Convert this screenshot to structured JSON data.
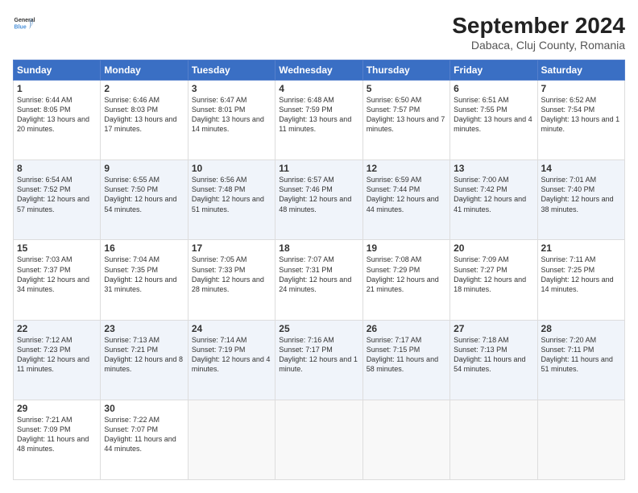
{
  "header": {
    "logo_general": "General",
    "logo_blue": "Blue",
    "title": "September 2024",
    "subtitle": "Dabaca, Cluj County, Romania"
  },
  "days_of_week": [
    "Sunday",
    "Monday",
    "Tuesday",
    "Wednesday",
    "Thursday",
    "Friday",
    "Saturday"
  ],
  "weeks": [
    [
      {
        "day": "1",
        "sunrise": "6:44 AM",
        "sunset": "8:05 PM",
        "daylight": "13 hours and 20 minutes."
      },
      {
        "day": "2",
        "sunrise": "6:46 AM",
        "sunset": "8:03 PM",
        "daylight": "13 hours and 17 minutes."
      },
      {
        "day": "3",
        "sunrise": "6:47 AM",
        "sunset": "8:01 PM",
        "daylight": "13 hours and 14 minutes."
      },
      {
        "day": "4",
        "sunrise": "6:48 AM",
        "sunset": "7:59 PM",
        "daylight": "13 hours and 11 minutes."
      },
      {
        "day": "5",
        "sunrise": "6:50 AM",
        "sunset": "7:57 PM",
        "daylight": "13 hours and 7 minutes."
      },
      {
        "day": "6",
        "sunrise": "6:51 AM",
        "sunset": "7:55 PM",
        "daylight": "13 hours and 4 minutes."
      },
      {
        "day": "7",
        "sunrise": "6:52 AM",
        "sunset": "7:54 PM",
        "daylight": "13 hours and 1 minute."
      }
    ],
    [
      {
        "day": "8",
        "sunrise": "6:54 AM",
        "sunset": "7:52 PM",
        "daylight": "12 hours and 57 minutes."
      },
      {
        "day": "9",
        "sunrise": "6:55 AM",
        "sunset": "7:50 PM",
        "daylight": "12 hours and 54 minutes."
      },
      {
        "day": "10",
        "sunrise": "6:56 AM",
        "sunset": "7:48 PM",
        "daylight": "12 hours and 51 minutes."
      },
      {
        "day": "11",
        "sunrise": "6:57 AM",
        "sunset": "7:46 PM",
        "daylight": "12 hours and 48 minutes."
      },
      {
        "day": "12",
        "sunrise": "6:59 AM",
        "sunset": "7:44 PM",
        "daylight": "12 hours and 44 minutes."
      },
      {
        "day": "13",
        "sunrise": "7:00 AM",
        "sunset": "7:42 PM",
        "daylight": "12 hours and 41 minutes."
      },
      {
        "day": "14",
        "sunrise": "7:01 AM",
        "sunset": "7:40 PM",
        "daylight": "12 hours and 38 minutes."
      }
    ],
    [
      {
        "day": "15",
        "sunrise": "7:03 AM",
        "sunset": "7:37 PM",
        "daylight": "12 hours and 34 minutes."
      },
      {
        "day": "16",
        "sunrise": "7:04 AM",
        "sunset": "7:35 PM",
        "daylight": "12 hours and 31 minutes."
      },
      {
        "day": "17",
        "sunrise": "7:05 AM",
        "sunset": "7:33 PM",
        "daylight": "12 hours and 28 minutes."
      },
      {
        "day": "18",
        "sunrise": "7:07 AM",
        "sunset": "7:31 PM",
        "daylight": "12 hours and 24 minutes."
      },
      {
        "day": "19",
        "sunrise": "7:08 AM",
        "sunset": "7:29 PM",
        "daylight": "12 hours and 21 minutes."
      },
      {
        "day": "20",
        "sunrise": "7:09 AM",
        "sunset": "7:27 PM",
        "daylight": "12 hours and 18 minutes."
      },
      {
        "day": "21",
        "sunrise": "7:11 AM",
        "sunset": "7:25 PM",
        "daylight": "12 hours and 14 minutes."
      }
    ],
    [
      {
        "day": "22",
        "sunrise": "7:12 AM",
        "sunset": "7:23 PM",
        "daylight": "12 hours and 11 minutes."
      },
      {
        "day": "23",
        "sunrise": "7:13 AM",
        "sunset": "7:21 PM",
        "daylight": "12 hours and 8 minutes."
      },
      {
        "day": "24",
        "sunrise": "7:14 AM",
        "sunset": "7:19 PM",
        "daylight": "12 hours and 4 minutes."
      },
      {
        "day": "25",
        "sunrise": "7:16 AM",
        "sunset": "7:17 PM",
        "daylight": "12 hours and 1 minute."
      },
      {
        "day": "26",
        "sunrise": "7:17 AM",
        "sunset": "7:15 PM",
        "daylight": "11 hours and 58 minutes."
      },
      {
        "day": "27",
        "sunrise": "7:18 AM",
        "sunset": "7:13 PM",
        "daylight": "11 hours and 54 minutes."
      },
      {
        "day": "28",
        "sunrise": "7:20 AM",
        "sunset": "7:11 PM",
        "daylight": "11 hours and 51 minutes."
      }
    ],
    [
      {
        "day": "29",
        "sunrise": "7:21 AM",
        "sunset": "7:09 PM",
        "daylight": "11 hours and 48 minutes."
      },
      {
        "day": "30",
        "sunrise": "7:22 AM",
        "sunset": "7:07 PM",
        "daylight": "11 hours and 44 minutes."
      },
      null,
      null,
      null,
      null,
      null
    ]
  ],
  "labels": {
    "sunrise": "Sunrise:",
    "sunset": "Sunset:",
    "daylight": "Daylight:"
  }
}
